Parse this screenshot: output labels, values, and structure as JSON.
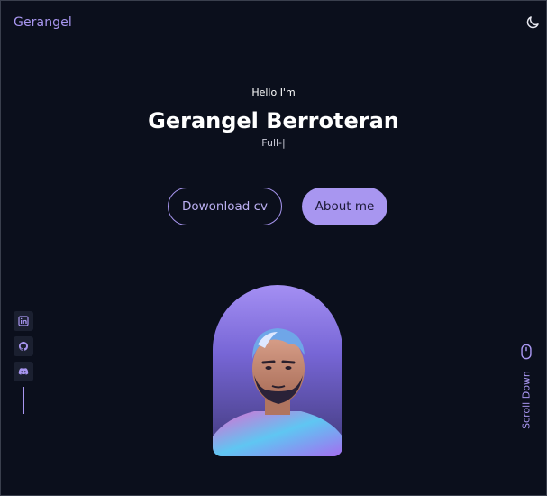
{
  "header": {
    "logo": "Gerangel",
    "theme_icon": "moon-icon"
  },
  "hero": {
    "greeting": "Hello I'm",
    "name": "Gerangel Berroteran",
    "role": "Full-|"
  },
  "buttons": {
    "download_cv": "Dowonload cv",
    "about_me": "About me"
  },
  "socials": [
    {
      "name": "linkedin",
      "icon": "linkedin-icon"
    },
    {
      "name": "github",
      "icon": "github-icon"
    },
    {
      "name": "discord",
      "icon": "discord-icon"
    }
  ],
  "scroll": {
    "label": "Scroll Down",
    "icon": "mouse-icon"
  },
  "colors": {
    "background": "#0b0f1c",
    "accent": "#a896f0",
    "text": "#ffffff"
  }
}
